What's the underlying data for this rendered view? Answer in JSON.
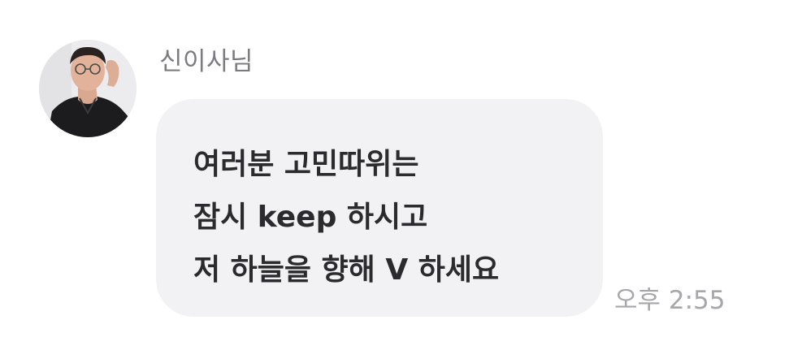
{
  "message": {
    "sender_name": "신이사님",
    "avatar_icon": "profile-photo",
    "lines": [
      "여러분 고민따위는",
      "잠시 keep 하시고",
      "저 하늘을 향해 V 하세요"
    ],
    "time": "오후 2:55"
  },
  "colors": {
    "bubble": "#f2f2f5",
    "text": "#2b2b2f",
    "sender": "#7c7c80",
    "time": "#a7a7ab"
  }
}
